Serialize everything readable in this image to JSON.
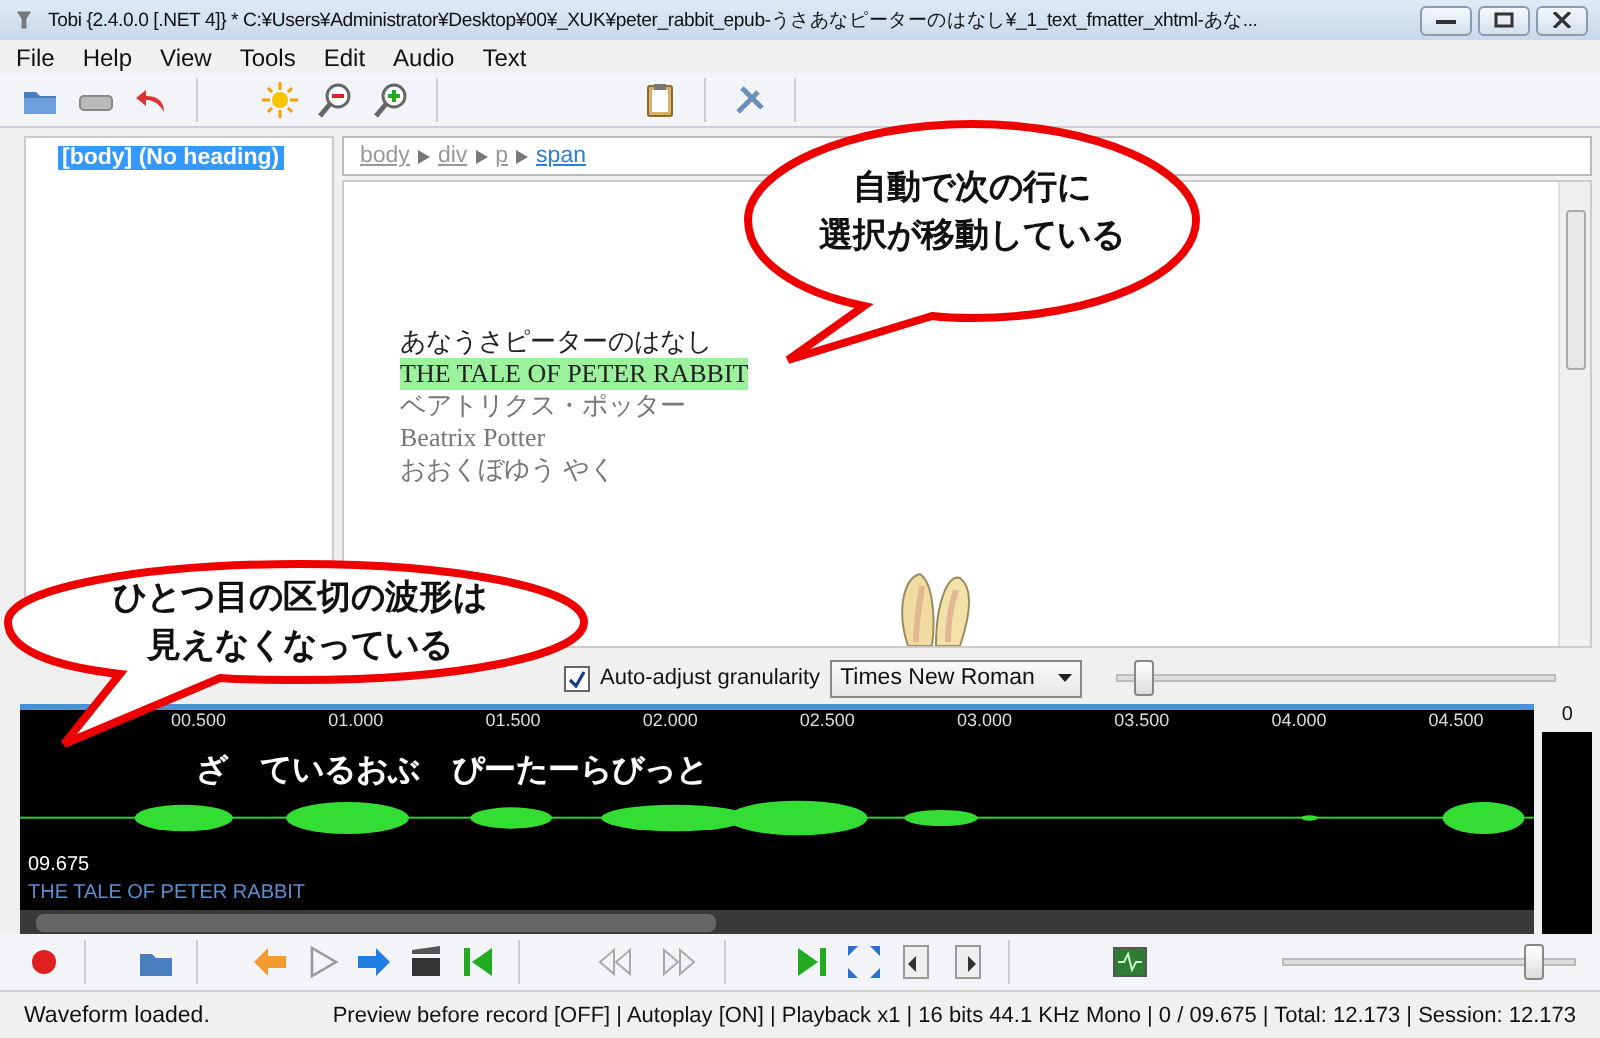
{
  "window": {
    "title": "Tobi {2.4.0.0 [.NET 4]} *  C:¥Users¥Administrator¥Desktop¥00¥_XUK¥peter_rabbit_epub-うさあなピーターのはなし¥_1_text_fmatter_xhtml-あな..."
  },
  "menu": [
    "File",
    "Help",
    "View",
    "Tools",
    "Edit",
    "Audio",
    "Text"
  ],
  "tree": {
    "items": [
      {
        "label": "[body] (No heading)",
        "selected": true
      }
    ]
  },
  "breadcrumb": [
    {
      "label": "body",
      "selected": false
    },
    {
      "label": "div",
      "selected": false
    },
    {
      "label": "p",
      "selected": false
    },
    {
      "label": "span",
      "selected": true
    }
  ],
  "document": {
    "lines": [
      {
        "text": "あなうさピーターのはなし",
        "selected": false,
        "dimmed": false
      },
      {
        "text": "THE TALE OF PETER RABBIT",
        "selected": true,
        "dimmed": false
      },
      {
        "text": "ベアトリクス・ポッター",
        "selected": false,
        "dimmed": true
      },
      {
        "text": "Beatrix Potter",
        "selected": false,
        "dimmed": true
      },
      {
        "text": "おおくぼゆう やく",
        "selected": false,
        "dimmed": true
      }
    ]
  },
  "options": {
    "auto_adjust": {
      "label": "Auto-adjust granularity",
      "checked": true
    },
    "font": "Times New Roman",
    "zoom": {
      "level": 0.06
    }
  },
  "waveform": {
    "ticks": [
      "00.500",
      "01.000",
      "01.500",
      "02.000",
      "02.500",
      "03.000",
      "03.500",
      "04.000",
      "04.500"
    ],
    "words": [
      "ざ",
      "ているおぶ",
      "ぴーたーらびっと"
    ],
    "time": "09.675",
    "phrase": "THE TALE OF PETER RABBIT",
    "meter": "0"
  },
  "transport": {
    "volume": {
      "level": 0.86
    }
  },
  "status_bar": {
    "message": "Waveform loaded.",
    "info": "Preview before record [OFF] | Autoplay [ON] | Playback x1 | 16 bits 44.1 KHz Mono | 0 / 09.675 | Total: 12.173 | Session: 12.173"
  },
  "callouts": [
    {
      "lines": [
        "自動で次の行に",
        "選択が移動している"
      ]
    },
    {
      "lines": [
        "ひとつ目の区切の波形は",
        "見えなくなっている"
      ]
    }
  ]
}
